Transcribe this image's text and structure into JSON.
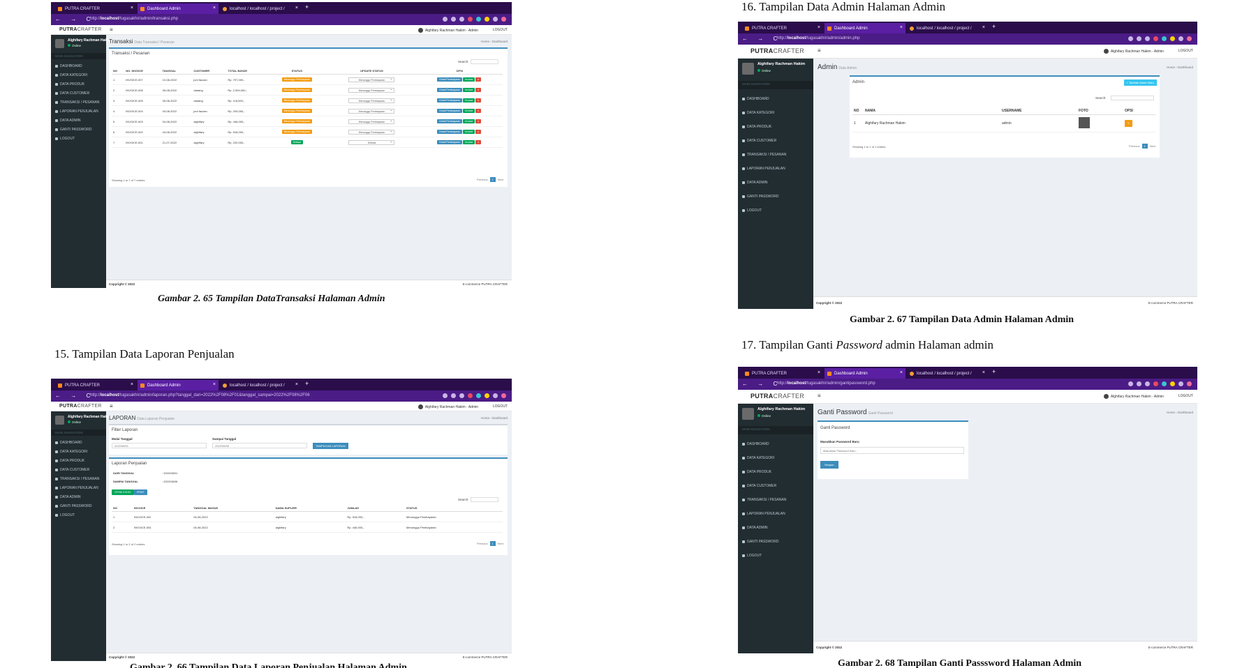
{
  "browser": {
    "tab1": "PUTRA CRAFTER",
    "tab2": "Dashboard Admin",
    "tab3": "localhost / localhost / project /",
    "url_prefix": "http://",
    "url_host": "localhost",
    "nav_arrows": "← → C"
  },
  "app": {
    "logo_bold": "PUTRA",
    "logo_rest": "CRAFTER",
    "header_user": "Alghifary Rachman Hakim - Admin",
    "logout": "LOGOUT",
    "sidebar_user": "Alghifary Rachman Hakim",
    "online": "Online",
    "nav_header": "MAIN NAVIGATION",
    "menu": [
      "DASHBOARD",
      "DATA KATEGORI",
      "DATA PRODUK",
      "DATA CUSTOMER",
      "TRANSAKSI / PESANAN",
      "LAPORAN PENJUALAN",
      "DATA ADMIN",
      "GANTI PASSWORD",
      "LOGOUT"
    ],
    "footer_left": "Copyright © 2022",
    "footer_right": "E-commerce PUTRA CRAFTER",
    "breadcrumb": "Home  ›  Dashboard",
    "search": "Search:",
    "previous": "Previous",
    "next": "Next",
    "page": "1"
  },
  "doc": {
    "caption_65": "Gambar 2. 65 Tampilan DataTransaksi Halaman Admin",
    "section_15": "15.  Tampilan Data Laporan Penjualan",
    "caption_66": "Gambar 2. 66 Tampilan Data Laporan Penjualan Halaman Admin",
    "section_16": "16.  Tampilan Data Admin Halaman Admin",
    "caption_67": "Gambar 2. 67 Tampilan Data Admin Halaman Admin",
    "section_17_a": "17.  Tampilan Ganti ",
    "section_17_b": "Password",
    "section_17_c": " admin Halaman admin",
    "caption_68": "Gambar 2. 68 Tampilan Ganti Passsword Halaman Admin"
  },
  "transaksi": {
    "url_path": "/tugasakhir/admin/transaksi.php",
    "title": "Transaksi",
    "subtitle": "Data Transaksi / Pesanan",
    "box_title": "Transaksi / Pesanan",
    "headers": [
      "NO",
      "NO. INVOICE",
      "TANGGAL",
      "CUSTOMER",
      "TOTAL BAYAR",
      "STATUS",
      "UPDATE STATUS",
      "OPSI"
    ],
    "rows": [
      [
        "1",
        "INVOICE-007",
        "10-08-2022",
        "joni fauzan",
        "Rp. 797,000,-",
        "Menunggu Pembayaran",
        "Menunggu Pembayaran"
      ],
      [
        "2",
        "INVOICE-006",
        "05-08-2022",
        "dadang",
        "Rp. 2,054,000,-",
        "Menunggu Pembayaran",
        "Menunggu Pembayaran"
      ],
      [
        "3",
        "INVOICE-005",
        "05-08-2022",
        "dadang",
        "Rp. 118,000,-",
        "Menunggu Pembayaran",
        "Menunggu Pembayaran"
      ],
      [
        "4",
        "INVOICE-004",
        "04-08-2022",
        "joni fauzan",
        "Rp. 293,000,-",
        "Menunggu Pembayaran",
        "Menunggu Pembayaran"
      ],
      [
        "5",
        "INVOICE-003",
        "04-08-2022",
        "alghifary",
        "Rp. 446,000,-",
        "Menunggu Pembayaran",
        "Menunggu Pembayaran"
      ],
      [
        "6",
        "INVOICE-002",
        "04-08-2022",
        "alghifary",
        "Rp. 518,000,-",
        "Menunggu Pembayaran",
        "Menunggu Pembayaran"
      ],
      [
        "7",
        "INVOICE-001",
        "21-07-2022",
        "alghifary",
        "Rp. 220,000,-",
        "Selesai",
        "Selesai"
      ]
    ],
    "btn_detail": "Detail Pembayaran",
    "btn_invoice": "Invoice",
    "btn_delete": "x",
    "showing": "Showing 1 to 7 of 7 entries"
  },
  "laporan": {
    "url_path": "/tugasakhir/admin/laporan.php?tanggal_dari=2022%2F08%2F01&tanggal_sampai=2022%2F08%2F06",
    "title": "LAPORAN",
    "subtitle": "Data Laporan Penjualan",
    "filter_title": "Filter Laporan",
    "label_from": "Mulai Tanggal",
    "label_to": "Sampai Tanggal",
    "value_from": "2022/08/01",
    "value_to": "2022/08/06",
    "btn_show": "TAMPILKAN LAPORAN",
    "report_title": "Laporan Penjualan",
    "dari_label": "DARI TANGGAL",
    "dari_value": ":  2022/08/01",
    "sampai_label": "SAMPAI TANGGAL",
    "sampai_value": ":  2022/08/06",
    "btn_excel": "CETAK EXCEL",
    "btn_print": "PRINT",
    "headers": [
      "NO",
      "INVOICE",
      "TANGGAL MASUK",
      "NAMA SUPLIER",
      "JUMLAH",
      "STATUS"
    ],
    "rows": [
      [
        "1",
        "INVOICE-002",
        "04-08-2022",
        "alghifary",
        "Rp. 518,000,-",
        "Menunggu Pembayaran"
      ],
      [
        "2",
        "INVOICE-003",
        "04-08-2022",
        "alghifary",
        "Rp. 446,000,-",
        "Menunggu Pembayaran"
      ]
    ],
    "showing": "Showing 1 to 2 of 2 entries"
  },
  "admin": {
    "url_path": "/tugasakhir/admin/admin.php",
    "title": "Admin",
    "subtitle": "Data Admin",
    "box_title": "Admin",
    "btn_add": "+ Tambah Admin Baru",
    "headers": [
      "NO",
      "NAMA",
      "USERNAME",
      "FOTO",
      "OPSI"
    ],
    "row": [
      "1",
      "Alghifary Rachman Hakim",
      "admin"
    ],
    "showing": "Showing 1 to 1 of 1 entries"
  },
  "password": {
    "url_path": "/tugasakhir/admin/gantipassword.php",
    "title": "Ganti Password",
    "subtitle": "Ganti Password",
    "box_title": "Ganti Password",
    "label": "Masukkan Password Baru",
    "placeholder": "Masukkan Password Baru ..",
    "btn_save": "Simpan"
  }
}
